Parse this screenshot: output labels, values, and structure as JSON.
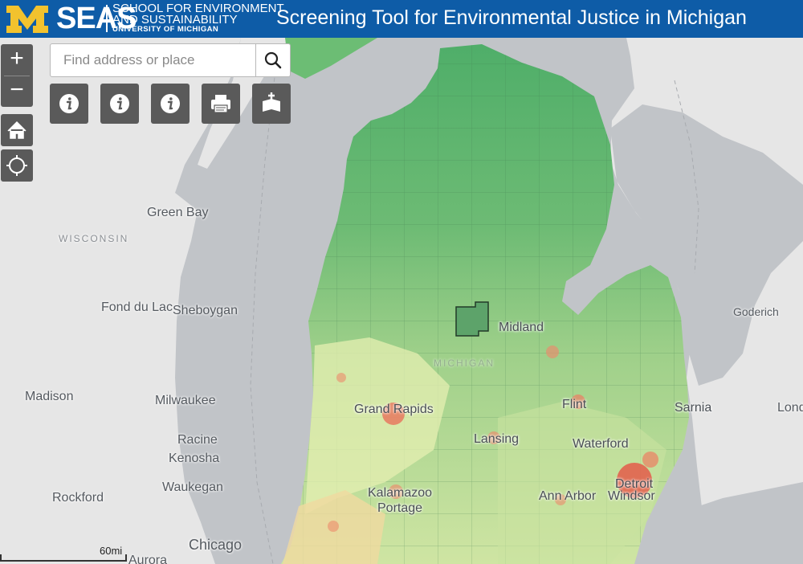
{
  "header": {
    "logo_mark": "M",
    "seas_word": "SEAS",
    "seas_line1": "SCHOOL FOR ENVIRONMENT",
    "seas_line2": "AND SUSTAINABILITY",
    "seas_line3": "UNIVERSITY OF MICHIGAN",
    "title": "Screening Tool for Environmental Justice in Michigan",
    "colors": {
      "bar": "#0e5ca7",
      "maize": "#f2c22e"
    }
  },
  "search": {
    "placeholder": "Find address or place"
  },
  "zoom": {
    "in_label": "+",
    "out_label": "−"
  },
  "toolbar": {
    "buttons": [
      {
        "icon": "info-icon"
      },
      {
        "icon": "info-icon"
      },
      {
        "icon": "info-icon"
      },
      {
        "icon": "print-icon"
      },
      {
        "icon": "basemap-icon"
      }
    ]
  },
  "map_labels": {
    "green_bay": "Green Bay",
    "wisconsin": "WISCONSIN",
    "fond_du_lac": "Fond du Lac",
    "sheboygan": "Sheboygan",
    "madison": "Madison",
    "milwaukee": "Milwaukee",
    "racine": "Racine",
    "kenosha": "Kenosha",
    "waukegan": "Waukegan",
    "rockford": "Rockford",
    "chicago": "Chicago",
    "aurora": "Aurora",
    "midland": "Midland",
    "grand_rapids": "Grand Rapids",
    "flint": "Flint",
    "sarnia": "Sarnia",
    "lansing": "Lansing",
    "waterford": "Waterford",
    "goderich": "Goderich",
    "london": "Lond",
    "detroit": "Detroit",
    "windsor": "Windsor",
    "ann_arbor": "Ann Arbor",
    "kalamazoo": "Kalamazoo",
    "portage": "Portage",
    "michigan_state": "MICHIGAN"
  },
  "scale": {
    "label": "60mi"
  },
  "legend_colors": {
    "water": "#c1c4c8",
    "land": "#e6e6e6",
    "low": "#2f9a55",
    "mid": "#e3edb0",
    "high": "#e8493f"
  }
}
